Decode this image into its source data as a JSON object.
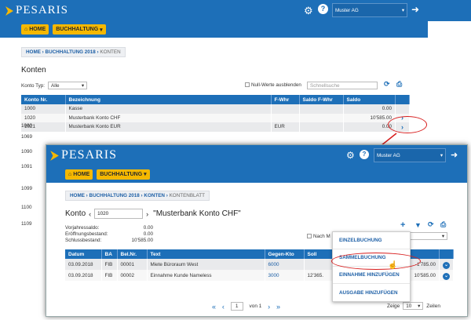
{
  "app": {
    "brand": "PESARIS",
    "company": "Muster AG",
    "nav": {
      "home": "HOME",
      "buchhaltung": "BUCHHALTUNG"
    }
  },
  "konten": {
    "breadcrumb": [
      "HOME",
      "BUCHHALTUNG 2018",
      "KONTEN"
    ],
    "title": "Konten",
    "filter_label": "Konto Typ:",
    "filter_value": "Alle",
    "null_label": "Null-Werte ausblenden",
    "search_placeholder": "Schnellsuche",
    "columns": [
      "Konto Nr.",
      "Bezeichnung",
      "F-Whr",
      "Saldo F-Whr",
      "Saldo"
    ],
    "rows": [
      {
        "nr": "1000",
        "name": "Kasse",
        "fwhr": "",
        "saldo_f": "",
        "saldo": "0.00"
      },
      {
        "nr": "1020",
        "name": "Musterbank Konto CHF",
        "fwhr": "",
        "saldo_f": "",
        "saldo": "10'585.00"
      },
      {
        "nr": "1021",
        "name": "Musterbank Konto EUR",
        "fwhr": "EUR",
        "saldo_f": "",
        "saldo": "0.00"
      }
    ],
    "hidden_rows": [
      "1060",
      "1069",
      "1090",
      "1091",
      "1099",
      "1100",
      "1109"
    ]
  },
  "kontenblatt": {
    "breadcrumb": [
      "HOME",
      "BUCHHALTUNG 2018",
      "KONTEN",
      "KONTENBLATT"
    ],
    "konto_label": "Konto",
    "konto_input": "1020",
    "konto_name": "\"Musterbank Konto CHF\"",
    "summary": [
      {
        "label": "Vorjahressaldo:",
        "value": "0.00"
      },
      {
        "label": "Eröffnungsbestand:",
        "value": "0.00"
      },
      {
        "label": "Schlussbestand:",
        "value": "10'585.00"
      }
    ],
    "null_label": "Nach M",
    "columns": [
      "Datum",
      "BA",
      "Bel.Nr.",
      "Text",
      "Gegen-Kto",
      "Soll",
      "",
      "Saldo"
    ],
    "rows": [
      {
        "datum": "03.09.2018",
        "ba": "FIB",
        "bel": "00001",
        "text": "Miete Büroraum West",
        "kto": "6000",
        "soll": "",
        "saldo": "-1'785.00"
      },
      {
        "datum": "03.09.2018",
        "ba": "FIB",
        "bel": "00002",
        "text": "Einnahme Kunde Nameless",
        "kto": "3000",
        "soll": "12'365.",
        "saldo": "10'585.00"
      }
    ],
    "menu": [
      "EINZELBUCHUNG",
      "SAMMELBUCHUNG",
      "EINNAHME HINZUFÜGEN",
      "AUSGABE HINZUFÜGEN"
    ],
    "pager": {
      "page": "1",
      "of": "von 1",
      "zeige": "Zeige",
      "size": "10",
      "zeilen": "Zeilen"
    }
  }
}
